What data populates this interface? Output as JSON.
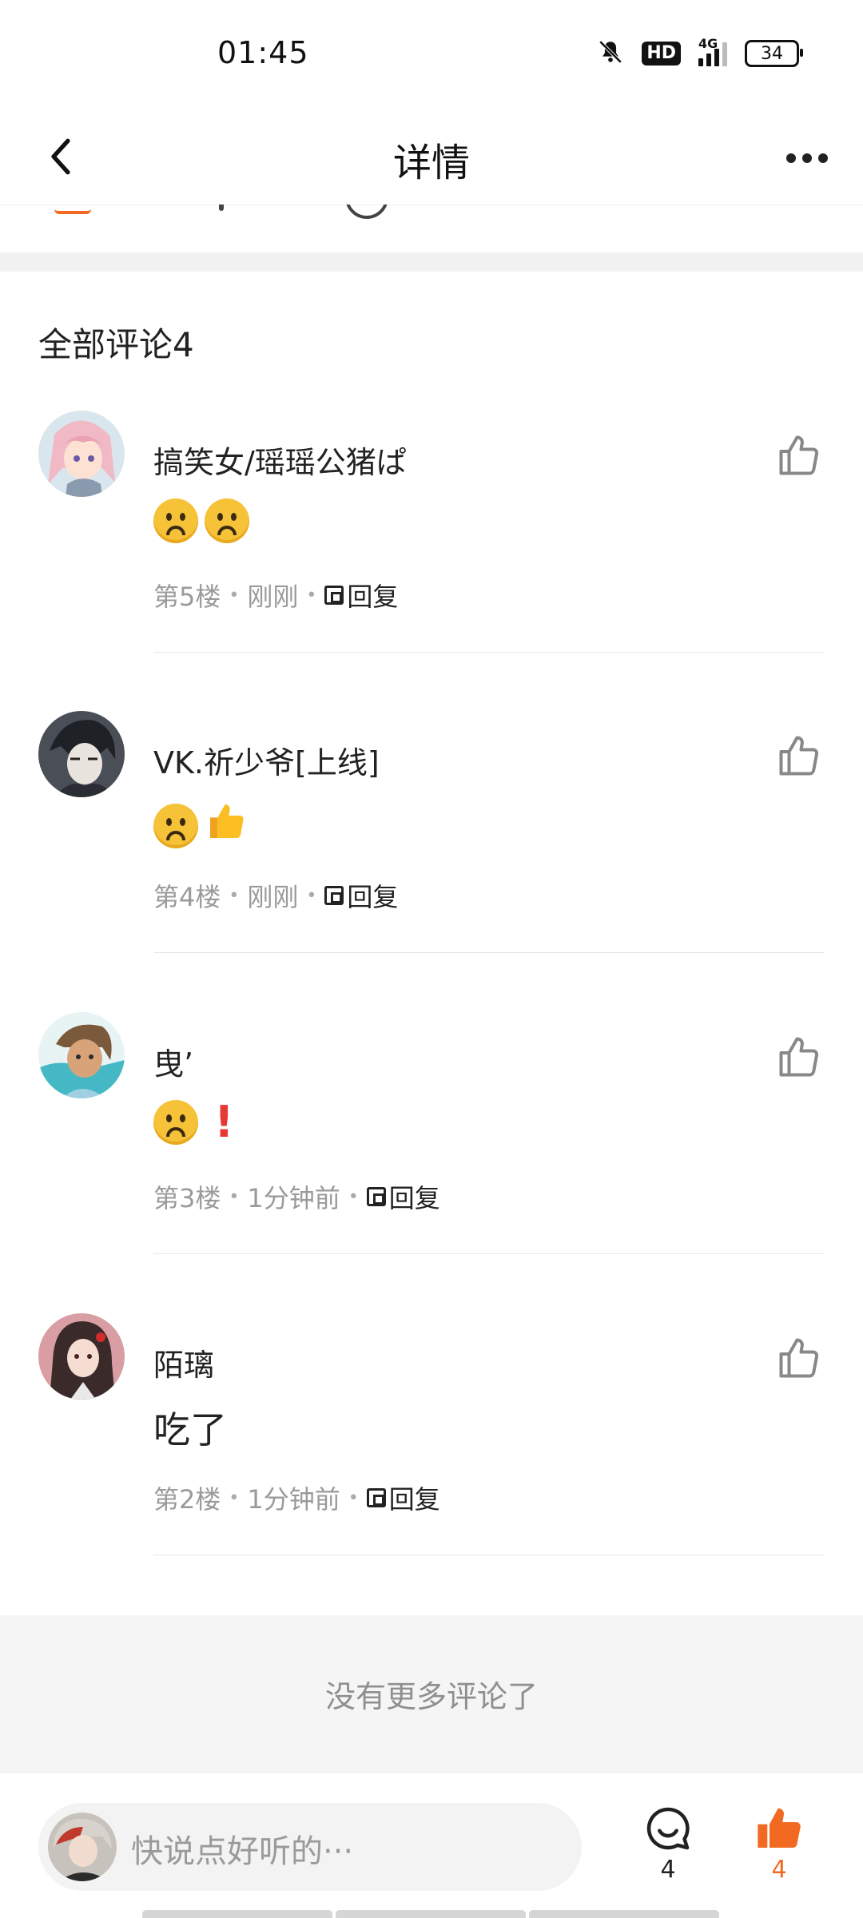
{
  "status_bar": {
    "time": "01:45",
    "hd_label": "HD",
    "network_label": "4G",
    "battery": "34",
    "icons": [
      "bell-mute-icon",
      "hd-icon",
      "signal-icon",
      "battery-icon"
    ]
  },
  "nav": {
    "title": "详情",
    "back_icon": "chevron-left-icon",
    "more_icon": "more-dots-icon"
  },
  "comments_section": {
    "title": "全部评论4"
  },
  "comments": [
    {
      "name": "搞笑女/瑶瑶公猪ぱ",
      "body_emojis": [
        "frowning-face",
        "frowning-face"
      ],
      "floor": "第5楼",
      "time": "刚刚",
      "reply": "回复"
    },
    {
      "name": "VK.祈少爷[上线]",
      "body_emojis": [
        "frowning-face",
        "thumbs-up"
      ],
      "floor": "第4楼",
      "time": "刚刚",
      "reply": "回复"
    },
    {
      "name": "曳’",
      "body_emojis": [
        "frowning-face",
        "exclamation"
      ],
      "floor": "第3楼",
      "time": "1分钟前",
      "reply": "回复"
    },
    {
      "name": "陌璃",
      "body_text": "吃了",
      "floor": "第2楼",
      "time": "1分钟前",
      "reply": "回复"
    }
  ],
  "footer": {
    "no_more": "没有更多评论了"
  },
  "bottom_bar": {
    "placeholder": "快说点好听的···",
    "comment_count": "4",
    "like_count": "4",
    "accent_color": "#f26a22"
  }
}
